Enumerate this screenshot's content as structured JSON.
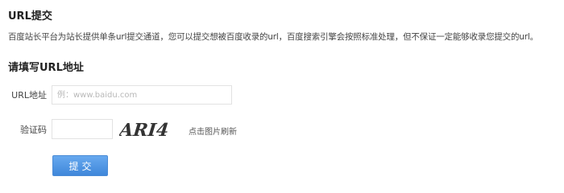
{
  "header": {
    "title": "URL提交",
    "description": "百度站长平台为站长提供单条url提交通道，您可以提交想被百度收录的url，百度搜索引擎会按照标准处理，但不保证一定能够收录您提交的url。"
  },
  "form": {
    "title": "请填写URL地址",
    "url_label": "URL地址",
    "url_placeholder": "例：www.baidu.com",
    "code_label": "验证码",
    "code_value": "",
    "captcha_text": "ARI4",
    "refresh_label": "点击图片刷新",
    "submit_label": "提交"
  },
  "colors": {
    "button_bg": "#4a8fde",
    "button_text": "#ffffff",
    "captcha_text": "#333333"
  }
}
